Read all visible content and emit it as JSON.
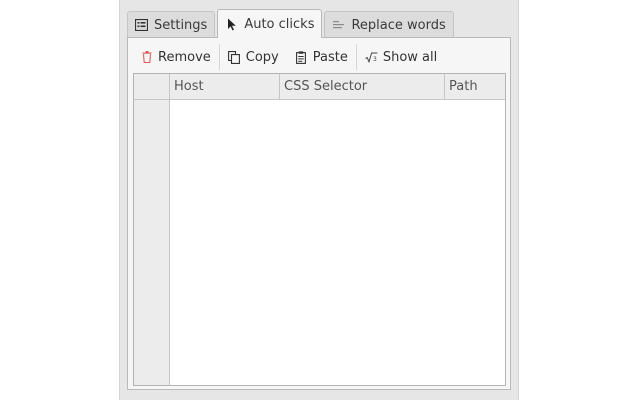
{
  "tabs": [
    {
      "label": "Settings",
      "icon": "settings-list-icon",
      "active": false
    },
    {
      "label": "Auto clicks",
      "icon": "cursor-icon",
      "active": true
    },
    {
      "label": "Replace words",
      "icon": "text-lines-icon",
      "active": false
    }
  ],
  "toolbar": {
    "remove_label": "Remove",
    "copy_label": "Copy",
    "paste_label": "Paste",
    "show_all_label": "Show all"
  },
  "table": {
    "columns": [
      "Host",
      "CSS Selector",
      "Path"
    ],
    "rows": []
  },
  "colors": {
    "remove_icon": "#e05a5a",
    "window_bg": "#e6e6e6",
    "panel_bg": "#f6f6f6"
  }
}
